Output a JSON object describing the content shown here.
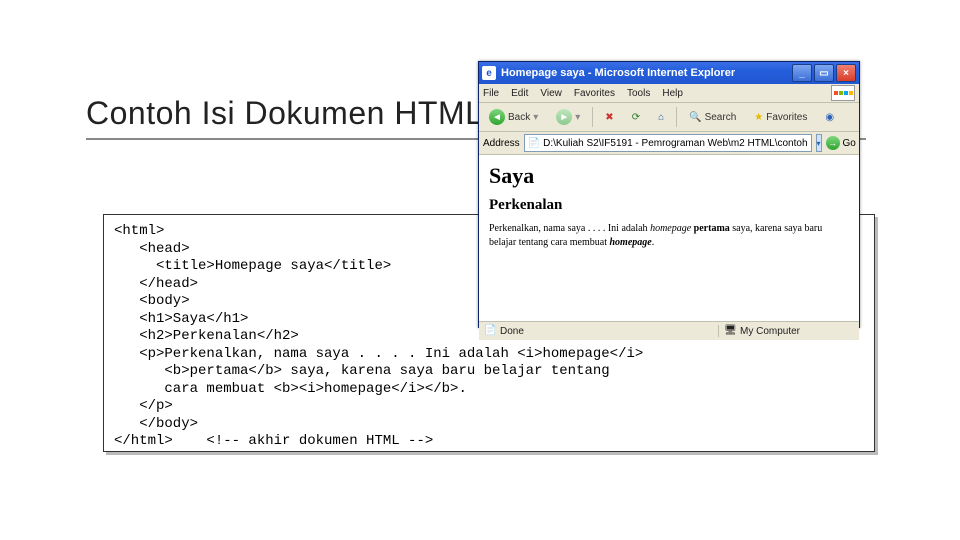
{
  "slide": {
    "heading": "Contoh Isi Dokumen HTML"
  },
  "code": {
    "line1": "<html>",
    "line2": "   <head>",
    "line3": "     <title>Homepage saya</title>",
    "line4": "   </head>",
    "line5": "   <body>",
    "line6": "   <h1>Saya</h1>",
    "line7": "   <h2>Perkenalan</h2>",
    "line8": "   <p>Perkenalkan, nama saya . . . . Ini adalah <i>homepage</i>",
    "line9": "      <b>pertama</b> saya, karena saya baru belajar tentang",
    "line10": "      cara membuat <b><i>homepage</i></b>.",
    "line11": "   </p>",
    "line12": "   </body>",
    "line13": "</html>    <!-- akhir dokumen HTML -->"
  },
  "ie": {
    "title": "Homepage saya - Microsoft Internet Explorer",
    "menu": {
      "file": "File",
      "edit": "Edit",
      "view": "View",
      "favorites": "Favorites",
      "tools": "Tools",
      "help": "Help"
    },
    "toolbar": {
      "back": "Back",
      "search": "Search",
      "favorites": "Favorites"
    },
    "addr": {
      "label": "Address",
      "value": "D:\\Kuliah S2\\IF5191 - Pemrograman Web\\m2 HTML\\contoh",
      "go": "Go"
    },
    "page": {
      "h1": "Saya",
      "h2": "Perkenalan",
      "p_a": "Perkenalkan, nama saya . . . . Ini adalah ",
      "p_b": "homepage",
      "p_c": " ",
      "p_d": "pertama",
      "p_e": " saya, karena saya baru belajar tentang cara membuat ",
      "p_f": "homepage",
      "p_g": "."
    },
    "status": {
      "done": "Done",
      "zone": "My Computer"
    }
  }
}
